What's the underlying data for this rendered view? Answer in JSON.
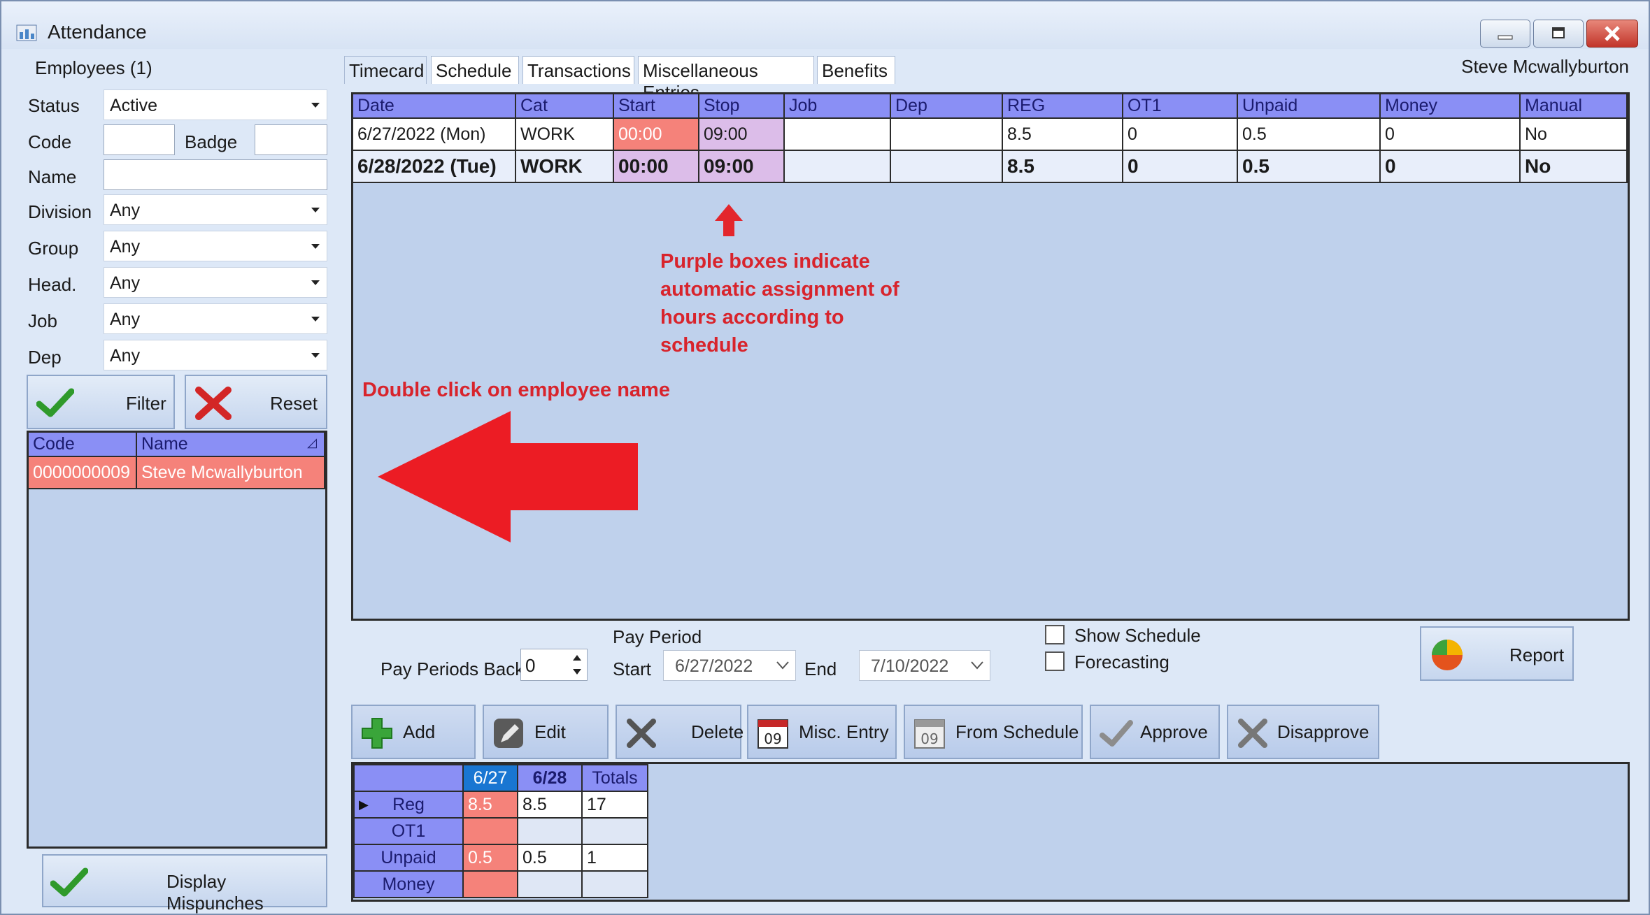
{
  "window": {
    "title": "Attendance",
    "user_name": "Steve Mcwallyburton"
  },
  "filters": {
    "employees_label": "Employees (1)",
    "status_label": "Status",
    "status_value": "Active",
    "code_label": "Code",
    "badge_label": "Badge",
    "name_label": "Name",
    "division_label": "Division",
    "division_value": "Any",
    "group_label": "Group",
    "group_value": "Any",
    "head_label": "Head.",
    "head_value": "Any",
    "job_label": "Job",
    "job_value": "Any",
    "dep_label": "Dep",
    "dep_value": "Any",
    "filter_button": "Filter",
    "reset_button": "Reset"
  },
  "employee_list": {
    "columns": [
      "Code",
      "Name"
    ],
    "rows": [
      {
        "code": "0000000009",
        "name": "Steve Mcwallyburton"
      }
    ]
  },
  "display_mispunches_button": "Display Mispunches",
  "tabs": [
    "Timecard",
    "Schedule",
    "Transactions",
    "Miscellaneous Entries",
    "Benefits"
  ],
  "timecard": {
    "columns": [
      "Date",
      "Cat",
      "Start",
      "Stop",
      "Job",
      "Dep",
      "REG",
      "OT1",
      "Unpaid",
      "Money",
      "Manual"
    ],
    "rows": [
      [
        "6/27/2022 (Mon)",
        "WORK",
        "00:00",
        "09:00",
        "",
        "",
        "8.5",
        "0",
        "0.5",
        "0",
        "No"
      ],
      [
        "6/28/2022 (Tue)",
        "WORK",
        "00:00",
        "09:00",
        "",
        "",
        "8.5",
        "0",
        "0.5",
        "0",
        "No"
      ]
    ]
  },
  "annotations": {
    "purple_note": [
      "Purple boxes indicate",
      "automatic assignment of",
      "hours according to",
      "schedule"
    ],
    "double_click_note": "Double click on employee name"
  },
  "pay_period": {
    "pay_periods_back_label": "Pay Periods Back",
    "pay_periods_back_value": "0",
    "title": "Pay Period",
    "start_label": "Start",
    "start_value": "6/27/2022",
    "end_label": "End",
    "end_value": "7/10/2022"
  },
  "options": {
    "show_schedule": "Show Schedule",
    "forecasting": "Forecasting",
    "report_button": "Report"
  },
  "actions": [
    "Add",
    "Edit",
    "Delete",
    "Misc. Entry",
    "From Schedule",
    "Approve",
    "Disapprove"
  ],
  "summary": {
    "columns": [
      "6/27",
      "6/28",
      "Totals"
    ],
    "rows": [
      {
        "label": "Reg",
        "values": [
          "8.5",
          "8.5",
          "17"
        ]
      },
      {
        "label": "OT1",
        "values": [
          "",
          "",
          ""
        ]
      },
      {
        "label": "Unpaid",
        "values": [
          "0.5",
          "0.5",
          "1"
        ]
      },
      {
        "label": "Money",
        "values": [
          "",
          "",
          ""
        ]
      }
    ]
  },
  "colors": {
    "header_purple": "#8a8ff5",
    "highlight_red": "#f5827a",
    "schedule_purple": "#dcbde9",
    "annotation_red": "#d8242c"
  }
}
